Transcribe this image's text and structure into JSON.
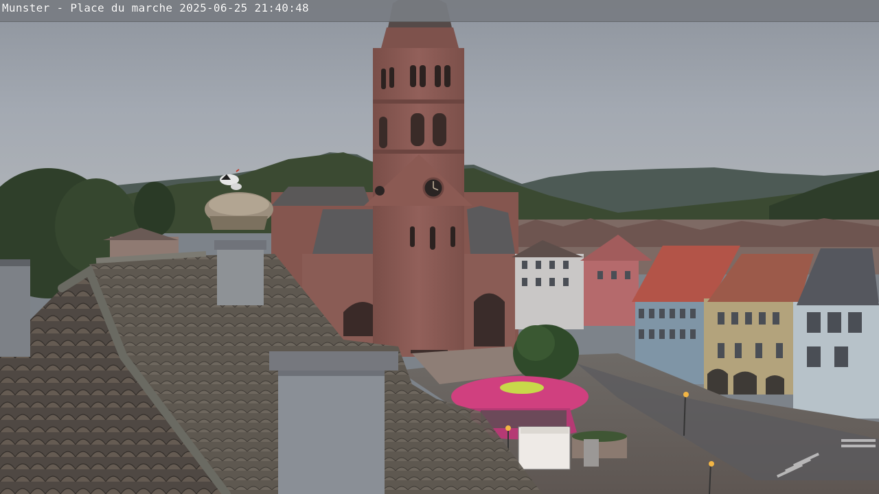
{
  "overlay": {
    "location": "Munster - Place du marche",
    "datetime": "2025-06-25 21:40:48"
  },
  "scene": {
    "description_tags": [
      "church-tower",
      "clock",
      "stork-nest",
      "tiled-roofs",
      "town-square",
      "carousel",
      "hills",
      "evening-sky"
    ]
  },
  "colors": {
    "sky": "#9aa1ab",
    "sandstone": "#8a5a52",
    "roof": "#5c5750",
    "carousel": "#d0407f",
    "hills": "#3b4a32"
  }
}
